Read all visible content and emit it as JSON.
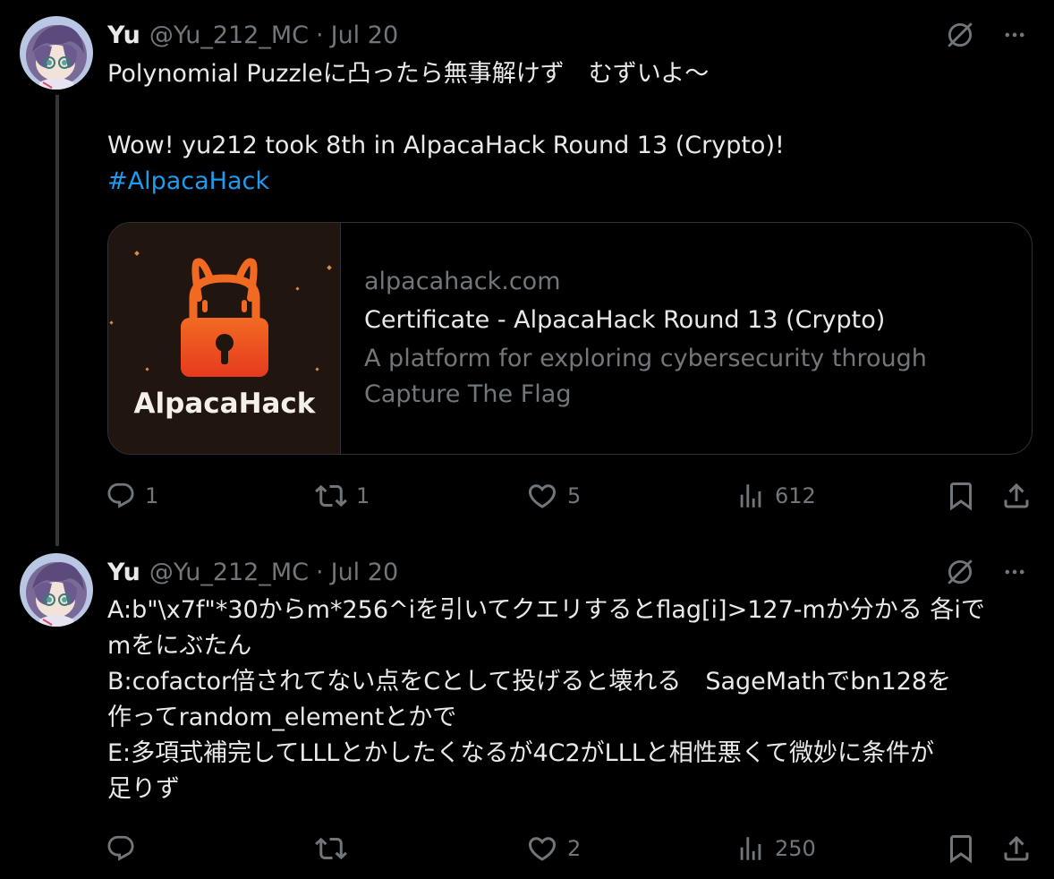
{
  "tweets": [
    {
      "author": {
        "name": "Yu",
        "handle": "@Yu_212_MC",
        "date": "Jul 20"
      },
      "lines": [
        "Polynomial Puzzleに凸ったら無事解けず　むずいよ〜",
        "",
        "Wow! yu212 took 8th in AlpacaHack Round 13 (Crypto)!"
      ],
      "hashtag": "#AlpacaHack",
      "card": {
        "logo_text": "AlpacaHack",
        "domain": "alpacahack.com",
        "title": "Certificate - AlpacaHack Round 13 (Crypto)",
        "description": "A platform for exploring cybersecurity through Capture The Flag"
      },
      "stats": {
        "replies": "1",
        "reposts": "1",
        "likes": "5",
        "views": "612"
      }
    },
    {
      "author": {
        "name": "Yu",
        "handle": "@Yu_212_MC",
        "date": "Jul 20"
      },
      "lines": [
        "A:b\"\\x7f\"*30からm*256^iを引いてクエリするとflag[i]>127-mか分かる 各iで",
        "mをにぶたん",
        "B:cofactor倍されてない点をCとして投げると壊れる　SageMathでbn128を",
        "作ってrandom_elementとかで",
        "E:多項式補完してLLLとかしたくなるが4C2がLLLと相性悪くて微妙に条件が",
        "足りず"
      ],
      "stats": {
        "replies": "",
        "reposts": "",
        "likes": "2",
        "views": "250"
      }
    }
  ],
  "icons": [
    "grok-icon",
    "more-icon",
    "reply-icon",
    "repost-icon",
    "like-icon",
    "views-icon",
    "bookmark-icon",
    "share-icon"
  ],
  "colors": {
    "background": "#000000",
    "text": "#e7e9ea",
    "muted": "#71767b",
    "link": "#1d9bf0",
    "border": "#2f3336",
    "brand_orange": "#f26a22"
  }
}
